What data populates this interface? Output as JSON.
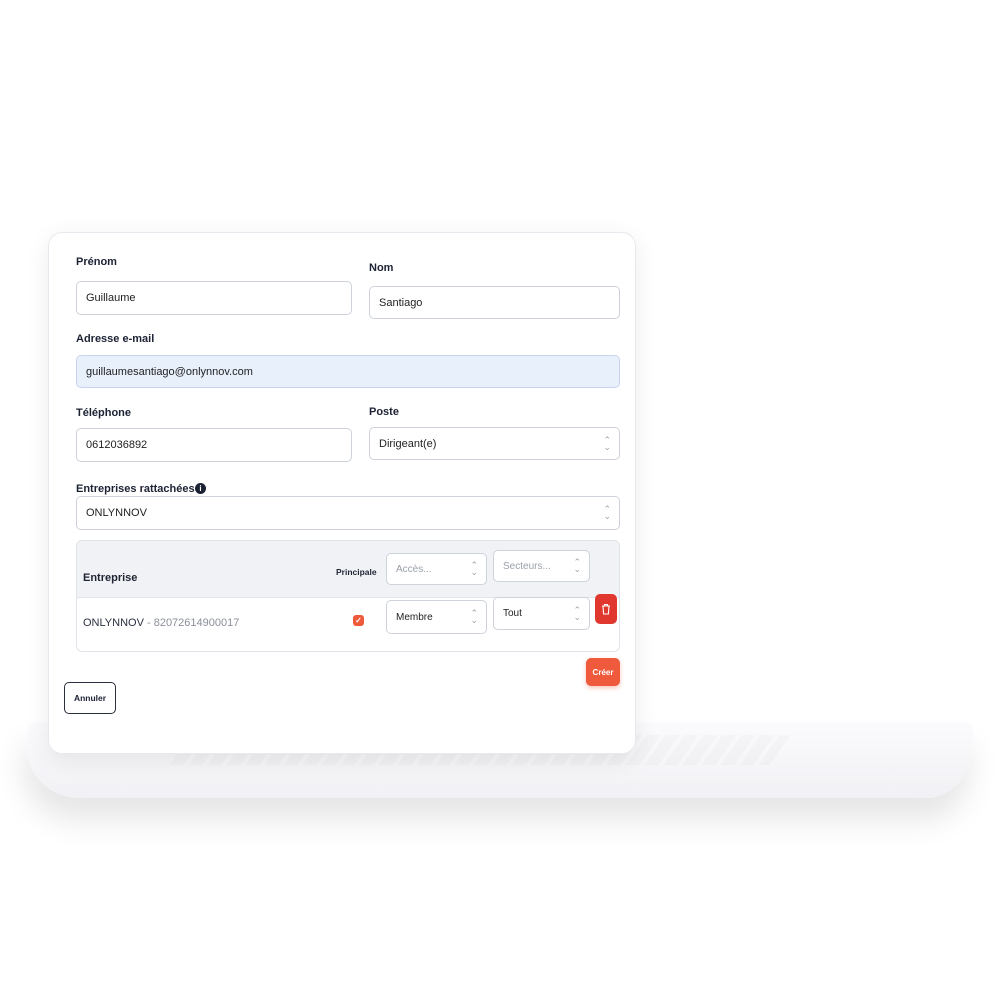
{
  "form": {
    "prenom_label": "Prénom",
    "prenom_value": "Guillaume",
    "nom_label": "Nom",
    "nom_value": "Santiago",
    "email_label": "Adresse e-mail",
    "email_value": "guillaumesantiago@onlynnov.com",
    "phone_label": "Téléphone",
    "phone_value": "0612036892",
    "poste_label": "Poste",
    "poste_value": "Dirigeant(e)",
    "companies_label": "Entreprises rattachées",
    "companies_value": "ONLYNNOV"
  },
  "table": {
    "col_entreprise": "Entreprise",
    "col_principale": "Principale",
    "acces_placeholder": "Accès...",
    "secteurs_placeholder": "Secteurs...",
    "rows": [
      {
        "company": "ONLYNNOV",
        "siret": "- 82072614900017",
        "principale_checked": true,
        "acces": "Membre",
        "secteurs": "Tout"
      }
    ]
  },
  "actions": {
    "create_label": "Créer",
    "cancel_label": "Annuler"
  },
  "colors": {
    "accent": "#ef5a3c",
    "delete": "#e0382e",
    "email_highlight": "#e8f0fc"
  },
  "icons": {
    "info": "info-icon",
    "chevron": "chevron-updown-icon",
    "delete": "trash-icon",
    "check": "check-icon"
  }
}
